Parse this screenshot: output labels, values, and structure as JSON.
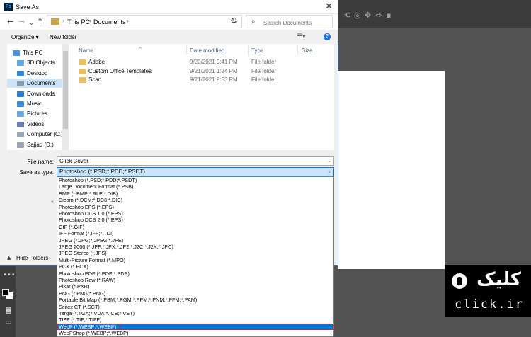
{
  "dialog": {
    "title": "Save As",
    "app_icon": "Ps",
    "close_glyph": "✕"
  },
  "nav": {
    "breadcrumb": [
      "This PC",
      "Documents"
    ],
    "search_placeholder": "Search Documents"
  },
  "toolbar": {
    "organize_label": "Organize ▾",
    "new_folder_label": "New folder"
  },
  "sidebar": {
    "items": [
      {
        "label": "This PC",
        "icon": "computer-icon",
        "color": "#4a90d9"
      },
      {
        "label": "3D Objects",
        "icon": "cube-icon",
        "color": "#5aa9e6"
      },
      {
        "label": "Desktop",
        "icon": "desktop-icon",
        "color": "#3a87d6"
      },
      {
        "label": "Documents",
        "icon": "documents-icon",
        "color": "#8a9bb0",
        "selected": true
      },
      {
        "label": "Downloads",
        "icon": "download-icon",
        "color": "#2e7bd4"
      },
      {
        "label": "Music",
        "icon": "music-icon",
        "color": "#3c8ad8"
      },
      {
        "label": "Pictures",
        "icon": "pictures-icon",
        "color": "#6aa8e0"
      },
      {
        "label": "Videos",
        "icon": "videos-icon",
        "color": "#6a7fb0"
      },
      {
        "label": "Computer (C:)",
        "icon": "drive-icon",
        "color": "#9aa6b5"
      },
      {
        "label": "Sajjad (D:)",
        "icon": "drive-icon",
        "color": "#9aa6b5"
      }
    ]
  },
  "files": {
    "headers": {
      "name": "Name",
      "date": "Date modified",
      "type": "Type",
      "size": "Size"
    },
    "rows": [
      {
        "name": "Adobe",
        "date": "9/20/2021 9:41 PM",
        "type": "File folder"
      },
      {
        "name": "Custom Office Templates",
        "date": "9/21/2021 1:24 PM",
        "type": "File folder"
      },
      {
        "name": "Scan",
        "date": "9/21/2021 9:53 PM",
        "type": "File folder"
      }
    ]
  },
  "form": {
    "filename_label": "File name:",
    "filename_value": "Click Cover",
    "savetype_label": "Save as type:",
    "savetype_value": "Photoshop (*.PSD;*.PDD;*.PSDT)"
  },
  "dropdown": {
    "options": [
      "Photoshop (*.PSD;*.PDD;*.PSDT)",
      "Large Document Format (*.PSB)",
      "BMP (*.BMP;*.RLE;*.DIB)",
      "Dicom (*.DCM;*.DC3;*.DIC)",
      "Photoshop EPS (*.EPS)",
      "Photoshop DCS 1.0 (*.EPS)",
      "Photoshop DCS 2.0 (*.EPS)",
      "GIF (*.GIF)",
      "IFF Format (*.IFF;*.TDI)",
      "JPEG (*.JPG;*.JPEG;*.JPE)",
      "JPEG 2000 (*.JPF;*.JPX;*.JP2;*.J2C;*.J2K;*.JPC)",
      "JPEG Stereo (*.JPS)",
      "Multi-Picture Format (*.MPO)",
      "PCX (*.PCX)",
      "Photoshop PDF (*.PDF;*.PDP)",
      "Photoshop Raw (*.RAW)",
      "Pixar (*.PXR)",
      "PNG (*.PNG;*.PNG)",
      "Portable Bit Map (*.PBM;*.PGM;*.PPM;*.PNM;*.PFM;*.PAM)",
      "Scitex CT (*.SCT)",
      "Targa (*.TGA;*.VDA;*.ICB;*.VST)",
      "TIFF (*.TIF;*.TIFF)",
      "WebP (*.WEBP;*.WEBP)",
      "WebPShop (*.WEBP;*.WEBP)"
    ],
    "selected_index": 22
  },
  "footer": {
    "hide_folders_label": "Hide Folders"
  },
  "logo": {
    "brand_text": "کلیک",
    "url_text": "click.ir"
  }
}
